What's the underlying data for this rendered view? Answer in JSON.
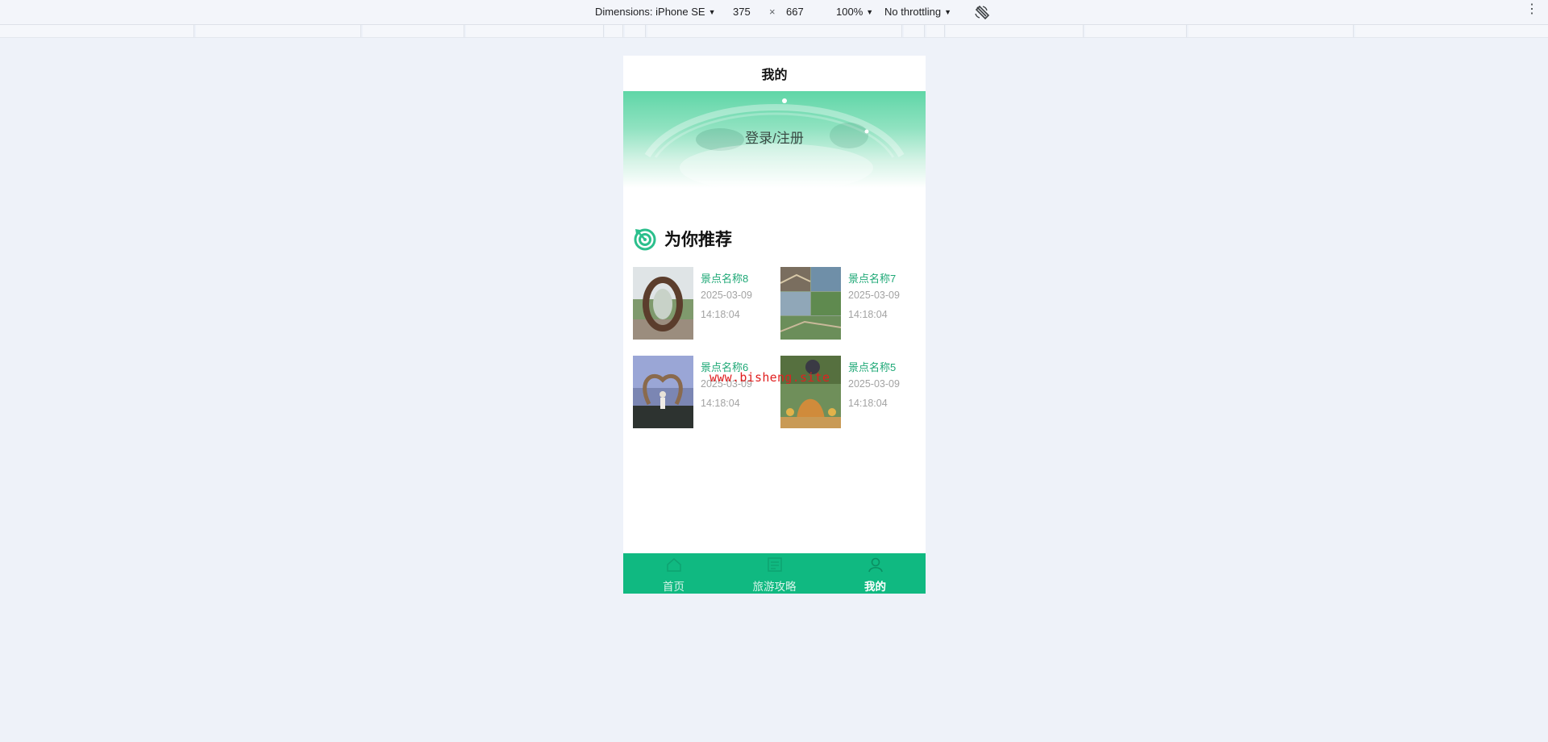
{
  "devtools": {
    "dimensions_label": "Dimensions: iPhone SE",
    "width": "375",
    "times": "×",
    "height": "667",
    "zoom": "100%",
    "throttling": "No throttling"
  },
  "page": {
    "title": "我的",
    "login_text": "登录/注册",
    "recommend_title": "为你推荐",
    "watermark": "www.bisheng.site"
  },
  "recommendations": [
    {
      "name": "景点名称8",
      "date": "2025-03-09",
      "time": "14:18:04"
    },
    {
      "name": "景点名称7",
      "date": "2025-03-09",
      "time": "14:18:04"
    },
    {
      "name": "景点名称6",
      "date": "2025-03-09",
      "time": "14:18:04"
    },
    {
      "name": "景点名称5",
      "date": "2025-03-09",
      "time": "14:18:04"
    }
  ],
  "tabbar": [
    {
      "label": "首页",
      "icon": "home-icon",
      "active": false
    },
    {
      "label": "旅游攻略",
      "icon": "guide-icon",
      "active": false
    },
    {
      "label": "我的",
      "icon": "user-icon",
      "active": true
    }
  ],
  "colors": {
    "accent": "#10b981",
    "item_name": "#1ea876",
    "page_background": "#eef2f9"
  }
}
